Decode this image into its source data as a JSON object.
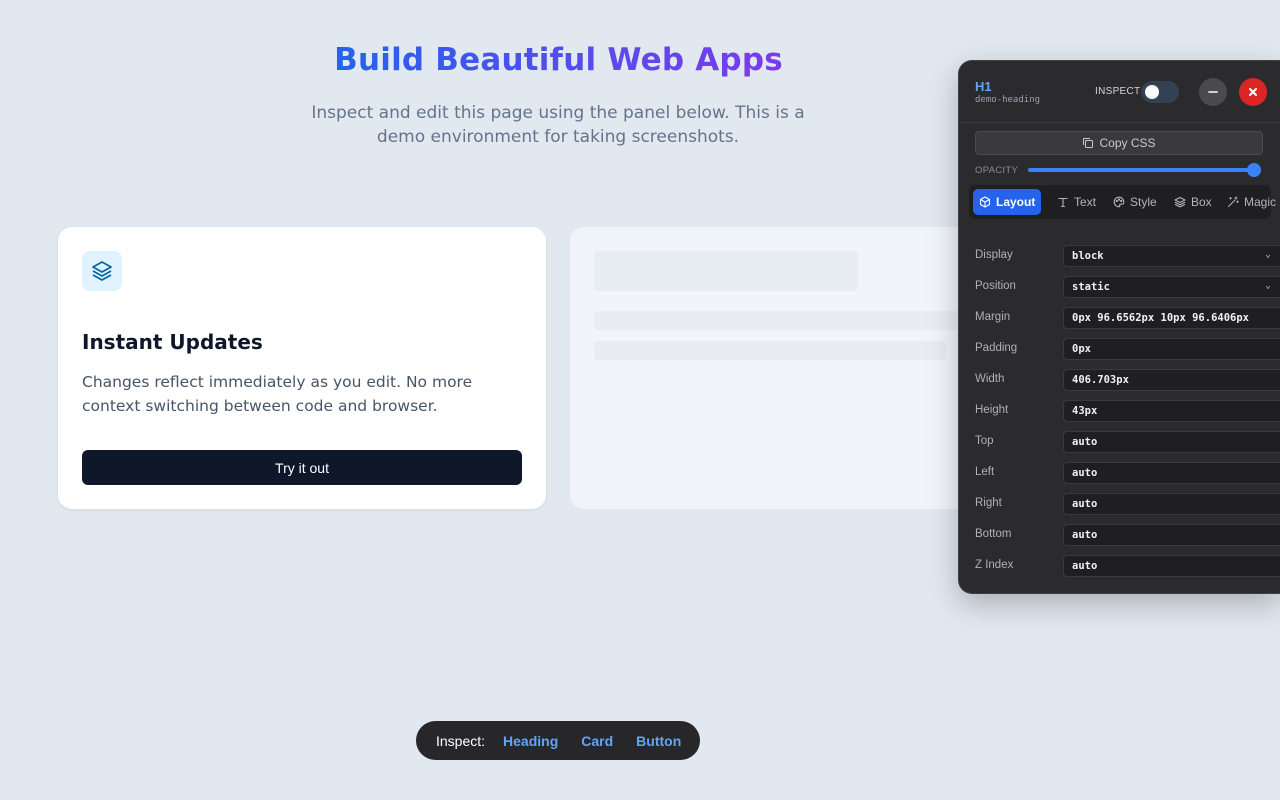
{
  "hero": {
    "title": "Build Beautiful Web Apps",
    "subtitle": "Inspect and edit this page using the panel below. This is a demo environment for taking screenshots."
  },
  "card": {
    "icon": "layers-icon",
    "title": "Instant Updates",
    "description": "Changes reflect immediately as you edit. No more context switching between code and browser.",
    "button_label": "Try it out"
  },
  "inspect_bar": {
    "label": "Inspect:",
    "links": [
      "Heading",
      "Card",
      "Button"
    ]
  },
  "panel": {
    "tag": "H1",
    "element_id": "demo-heading",
    "inspect_label": "INSPECT",
    "inspect_on": false,
    "copy_label": "Copy CSS",
    "opacity_label": "OPACITY",
    "opacity_value": 1.0,
    "tabs": [
      {
        "label": "Layout",
        "icon": "cube-icon",
        "active": true
      },
      {
        "label": "Text",
        "icon": "text-icon",
        "active": false
      },
      {
        "label": "Style",
        "icon": "palette-icon",
        "active": false
      },
      {
        "label": "Box",
        "icon": "layers-icon",
        "active": false
      },
      {
        "label": "Magic",
        "icon": "magic-wand-icon",
        "active": false
      }
    ],
    "properties": [
      {
        "label": "Display",
        "value": "block",
        "type": "select"
      },
      {
        "label": "Position",
        "value": "static",
        "type": "select"
      },
      {
        "label": "Margin",
        "value": "0px 96.6562px 10px 96.6406px",
        "type": "text"
      },
      {
        "label": "Padding",
        "value": "0px",
        "type": "text"
      },
      {
        "label": "Width",
        "value": "406.703px",
        "type": "text"
      },
      {
        "label": "Height",
        "value": "43px",
        "type": "text"
      },
      {
        "label": "Top",
        "value": "auto",
        "type": "text"
      },
      {
        "label": "Left",
        "value": "auto",
        "type": "text"
      },
      {
        "label": "Right",
        "value": "auto",
        "type": "text"
      },
      {
        "label": "Bottom",
        "value": "auto",
        "type": "text"
      },
      {
        "label": "Z Index",
        "value": "auto",
        "type": "text"
      }
    ]
  },
  "colors": {
    "background": "#e2e8f0",
    "accent": "#2563eb",
    "gradient_end": "#7c3aed",
    "close": "#dc2626",
    "link": "#60a5fa"
  }
}
